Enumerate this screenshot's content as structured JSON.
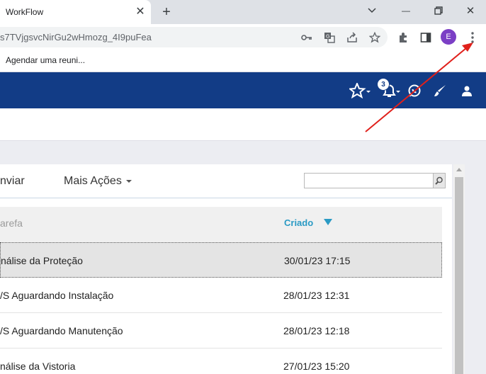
{
  "tab": {
    "title": "WorkFlow",
    "close_glyph": "✕",
    "new_tab_glyph": "+"
  },
  "window": {
    "minimize_glyph": "—",
    "close_glyph": "✕"
  },
  "omnibox": {
    "url": "s7TVjgsvcNirGu2wHmozg_4I9puFea"
  },
  "profile": {
    "initial": "E",
    "color": "#7b3fc5"
  },
  "bookmarks": [
    {
      "label": "Agendar uma reuni..."
    }
  ],
  "header": {
    "notification_count": "3",
    "background": "#123c86"
  },
  "actions": {
    "send": "nviar",
    "more": "Mais Ações"
  },
  "search": {
    "value": "",
    "placeholder": ""
  },
  "table": {
    "columns": {
      "task": "arefa",
      "created": "Criado"
    },
    "rows": [
      {
        "task": "nálise da Proteção",
        "created": "30/01/23 17:15",
        "selected": true
      },
      {
        "task": "/S Aguardando Instalação",
        "created": "28/01/23 12:31",
        "selected": false
      },
      {
        "task": "/S Aguardando Manutenção",
        "created": "28/01/23 12:18",
        "selected": false
      },
      {
        "task": "nálise da Vistoria",
        "created": "27/01/23 15:20",
        "selected": false
      }
    ]
  },
  "colors": {
    "accent": "#2a9ac4",
    "annotation_arrow": "#e0201b"
  }
}
